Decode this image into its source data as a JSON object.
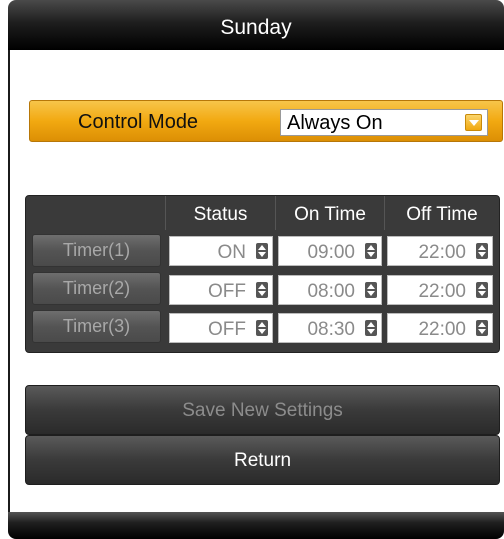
{
  "header": {
    "title": "Sunday"
  },
  "control_mode": {
    "label": "Control Mode",
    "value": "Always On"
  },
  "table": {
    "headers": [
      "Status",
      "On Time",
      "Off Time"
    ],
    "rows": [
      {
        "name": "Timer(1)",
        "status": "ON",
        "on_time": "09:00",
        "off_time": "22:00"
      },
      {
        "name": "Timer(2)",
        "status": "OFF",
        "on_time": "08:00",
        "off_time": "22:00"
      },
      {
        "name": "Timer(3)",
        "status": "OFF",
        "on_time": "08:30",
        "off_time": "22:00"
      }
    ]
  },
  "buttons": {
    "save": "Save New Settings",
    "return": "Return"
  },
  "colors": {
    "accent": "#f2a911",
    "panel": "#3a3a3a",
    "bar": "#000000"
  }
}
